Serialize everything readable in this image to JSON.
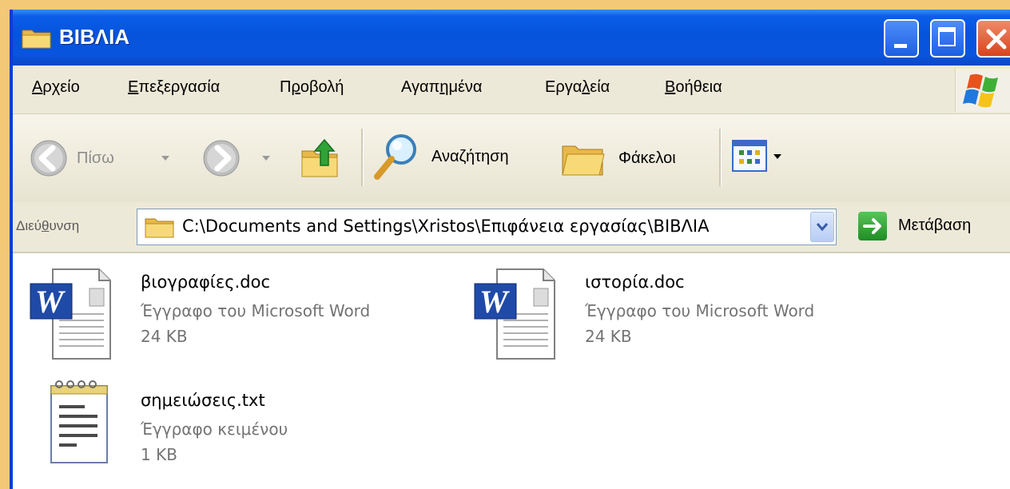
{
  "window": {
    "title": "ΒΙΒΛΙΑ"
  },
  "menu": {
    "items": [
      {
        "label": "Αρχείο",
        "underline": "Α"
      },
      {
        "label": "Επεξεργασία",
        "underline": "Ε"
      },
      {
        "label": "Προβολή",
        "underline": "ρ"
      },
      {
        "label": "Αγαπημένα",
        "underline": "η"
      },
      {
        "label": "Εργαλεία",
        "underline": "λ"
      },
      {
        "label": "Βοήθεια",
        "underline": "Β"
      }
    ]
  },
  "toolbar": {
    "back_label": "Πίσω",
    "search_label": "Αναζήτηση",
    "folders_label": "Φάκελοι"
  },
  "address": {
    "label": "Διεύθυνση",
    "label_underline": "θ",
    "path": "C:\\Documents and Settings\\Xristos\\Επιφάνεια εργασίας\\ΒΙΒΛΙΑ",
    "go_label": "Μετάβαση"
  },
  "files": [
    {
      "name": "βιογραφίες.doc",
      "type": "Έγγραφο του Microsoft Word",
      "size": "24 KB",
      "icon": "word-document-icon"
    },
    {
      "name": "ιστορία.doc",
      "type": "Έγγραφο του Microsoft Word",
      "size": "24 KB",
      "icon": "word-document-icon"
    },
    {
      "name": "σημειώσεις.txt",
      "type": "Έγγραφο κειμένου",
      "size": "1 KB",
      "icon": "text-document-icon"
    }
  ],
  "colors": {
    "titlebar": "#0653dc",
    "menubar": "#ede9d8",
    "desktop": "#f3c978",
    "secondary_text": "#737373"
  }
}
